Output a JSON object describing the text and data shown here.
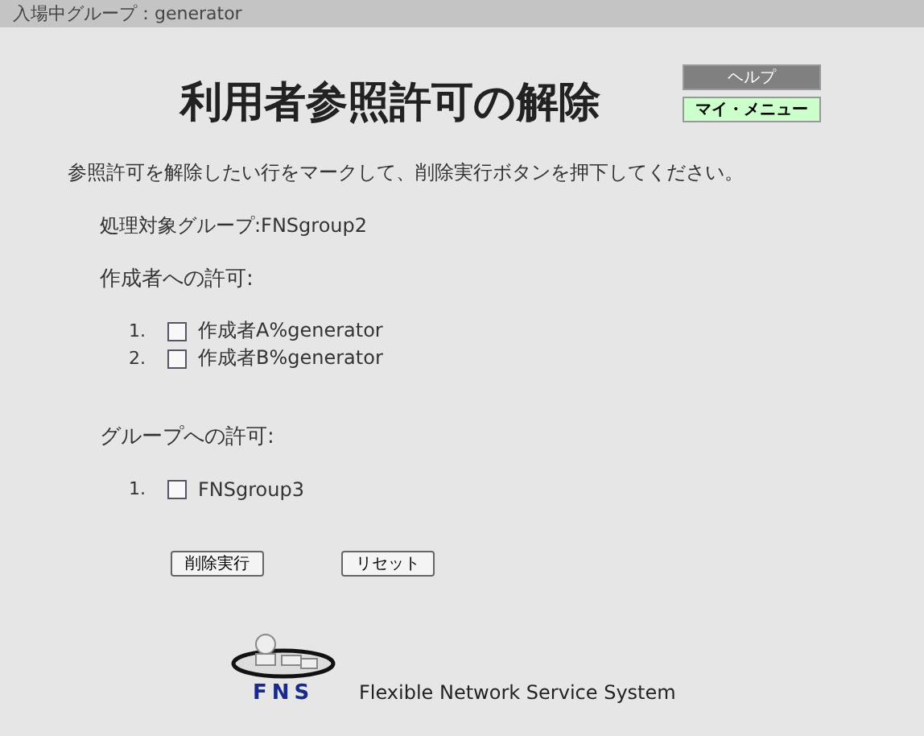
{
  "header": {
    "label": "入場中グループ：generator"
  },
  "title": "利用者参照許可の解除",
  "side_buttons": [
    {
      "label": "ヘルプ",
      "kind": "help"
    },
    {
      "label": "マイ・メニュー",
      "kind": "menu"
    }
  ],
  "instruction": "参照許可を解除したい行をマークして、削除実行ボタンを押下してください。",
  "target_group": "処理対象グループ:FNSgroup2",
  "sections": [
    {
      "heading": "作成者への許可:",
      "items": [
        {
          "number": "1.",
          "label": "作成者A%generator",
          "checked": false
        },
        {
          "number": "2.",
          "label": "作成者B%generator",
          "checked": false
        }
      ]
    },
    {
      "heading": "グループへの許可:",
      "items": [
        {
          "number": "1.",
          "label": "FNSgroup3",
          "checked": false
        }
      ]
    }
  ],
  "buttons": [
    "削除実行",
    "リセット"
  ],
  "footer": {
    "logo_text": "FNS",
    "tagline": "Flexible Network Service System"
  }
}
